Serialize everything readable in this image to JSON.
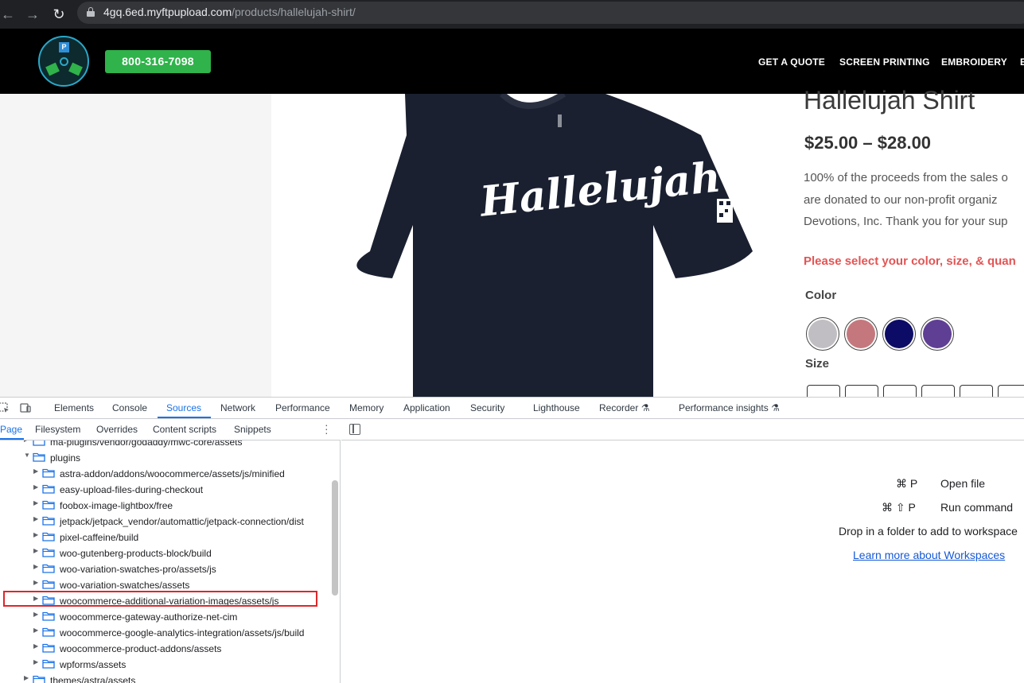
{
  "browser": {
    "url_host": "4gq.6ed.myftpupload.com",
    "url_path": "/products/hallelujah-shirt/"
  },
  "site": {
    "phone": "800-316-7098",
    "nav": [
      "GET A QUOTE",
      "SCREEN PRINTING",
      "EMBROIDERY",
      "E"
    ]
  },
  "product": {
    "shirt_text": "Hallelujah",
    "title": "Hallelujah Shirt",
    "price": "$25.00 – $28.00",
    "description": [
      "100% of the proceeds from the sales o",
      "are donated to our non-profit organiz",
      "Devotions, Inc.  Thank you for your sup"
    ],
    "notice": "Please select your color, size, & quan",
    "color_label": "Color",
    "size_label": "Size",
    "colors": [
      "#c0bec2",
      "#c4787e",
      "#0c0c66",
      "#5e3f94"
    ]
  },
  "devtools": {
    "tabs": [
      "Elements",
      "Console",
      "Sources",
      "Network",
      "Performance",
      "Memory",
      "Application",
      "Security",
      "Lighthouse",
      "Recorder",
      "Performance insights"
    ],
    "active_tab": "Sources",
    "sub_tabs": [
      "Page",
      "Filesystem",
      "Overrides",
      "Content scripts",
      "Snippets"
    ],
    "active_sub_tab": "Page",
    "tree": [
      {
        "label": "ma-plugins/vendor/godaddy/mwc-core/assets",
        "expanded": false,
        "depth": 1
      },
      {
        "label": "plugins",
        "expanded": true,
        "depth": 1
      },
      {
        "label": "astra-addon/addons/woocommerce/assets/js/minified",
        "expanded": false,
        "depth": 2
      },
      {
        "label": "easy-upload-files-during-checkout",
        "expanded": false,
        "depth": 2
      },
      {
        "label": "foobox-image-lightbox/free",
        "expanded": false,
        "depth": 2
      },
      {
        "label": "jetpack/jetpack_vendor/automattic/jetpack-connection/dist",
        "expanded": false,
        "depth": 2
      },
      {
        "label": "pixel-caffeine/build",
        "expanded": false,
        "depth": 2
      },
      {
        "label": "woo-gutenberg-products-block/build",
        "expanded": false,
        "depth": 2
      },
      {
        "label": "woo-variation-swatches-pro/assets/js",
        "expanded": false,
        "depth": 2
      },
      {
        "label": "woo-variation-swatches/assets",
        "expanded": false,
        "depth": 2
      },
      {
        "label": "woocommerce-additional-variation-images/assets/js",
        "expanded": false,
        "depth": 2
      },
      {
        "label": "woocommerce-gateway-authorize-net-cim",
        "expanded": false,
        "depth": 2
      },
      {
        "label": "woocommerce-google-analytics-integration/assets/js/build",
        "expanded": false,
        "depth": 2
      },
      {
        "label": "woocommerce-product-addons/assets",
        "expanded": false,
        "depth": 2
      },
      {
        "label": "wpforms/assets",
        "expanded": false,
        "depth": 2
      },
      {
        "label": "themes/astra/assets",
        "expanded": false,
        "depth": 1
      }
    ],
    "shortcuts": [
      {
        "keys": "⌘ P",
        "label": "Open file"
      },
      {
        "keys": "⌘ ⇧ P",
        "label": "Run command"
      }
    ],
    "drop_text": "Drop in a folder to add to workspace",
    "learn_link": "Learn more about Workspaces",
    "accent": "#1a73e8"
  }
}
